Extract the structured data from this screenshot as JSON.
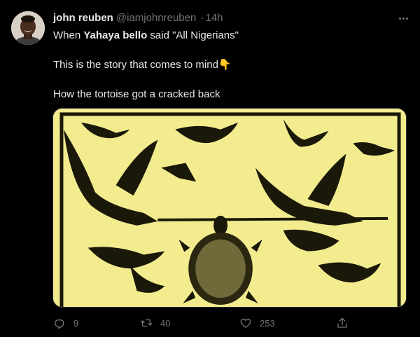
{
  "tweet": {
    "author": {
      "display_name": "john reuben",
      "handle": "@iamjohnreuben"
    },
    "separator": "·",
    "time": "14h",
    "text": {
      "line1_prefix": "When ",
      "line1_bold": "Yahaya bello",
      "line1_suffix": " said \"All Nigerians\"",
      "line2": "This is the story that comes to mind",
      "line2_emoji": "👇",
      "line3": "How the tortoise got a cracked back"
    },
    "media_alt": "woodcut of birds carrying a tortoise on a stick",
    "actions": {
      "reply_count": "9",
      "retweet_count": "40",
      "like_count": "253"
    }
  },
  "icons": {
    "more": "more-dots-icon",
    "reply": "reply-icon",
    "retweet": "retweet-icon",
    "like": "heart-icon",
    "share": "share-icon"
  },
  "colors": {
    "background": "#000000",
    "text_primary": "#e7e9ea",
    "text_secondary": "#71767b",
    "media_background": "#f3ec8f"
  }
}
